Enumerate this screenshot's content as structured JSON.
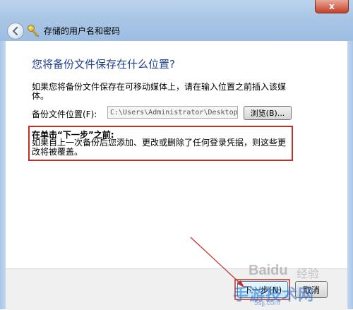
{
  "window": {
    "close_glyph": "x",
    "title": "存储的用户名和密码"
  },
  "main": {
    "heading": "您将备份文件保存在什么位置?",
    "instruction": "如果您将备份文件保存在可移动媒体上，请在输入位置之前插入该媒体。",
    "path_label": "备份文件位置(F):",
    "path_value": "C:\\Users\\Administrator\\Desktop\\",
    "browse_label": "浏览(B)...",
    "warning_title": "在单击“下一步”之前:",
    "warning_body": "如果自上一次备份后您添加、更改或删除了任何登录凭据，则这些更改将被覆盖。"
  },
  "footer": {
    "next_label": "下一步(N)",
    "cancel_label": "取消"
  },
  "watermark": {
    "baidu": "Baidu",
    "baidu_cn": "经验",
    "site": "手游技术网",
    "url": "5sjj.com"
  },
  "colors": {
    "heading": "#1f3f8f",
    "annotation": "#c0302a"
  },
  "icons": {
    "back": "back-arrow-icon",
    "key": "key-icon"
  }
}
